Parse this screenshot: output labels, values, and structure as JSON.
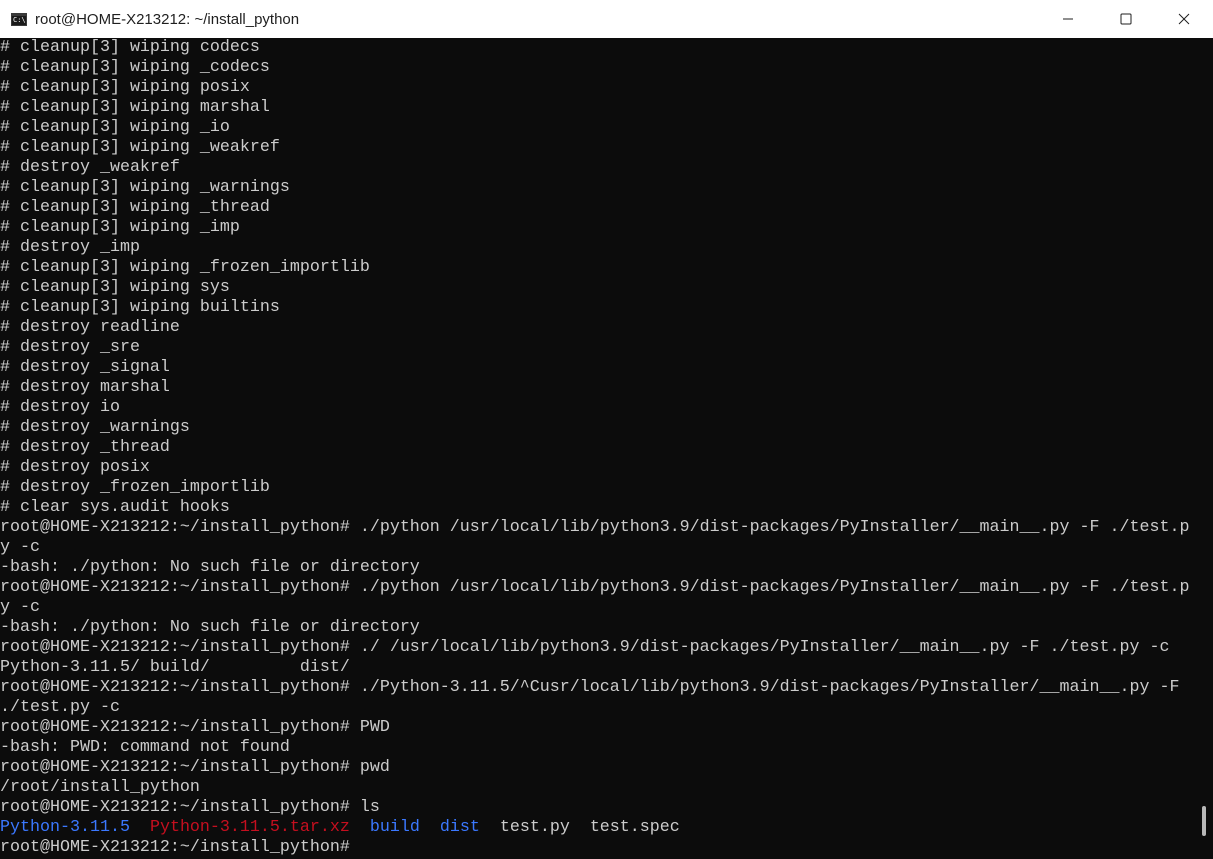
{
  "window": {
    "title": "root@HOME-X213212: ~/install_python",
    "icon": "terminal-app-icon",
    "icon_label": "C:\\",
    "controls": [
      "minimize-icon",
      "maximize-icon",
      "close-icon"
    ]
  },
  "terminal": {
    "lines": [
      "# cleanup[3] wiping codecs",
      "# cleanup[3] wiping _codecs",
      "# cleanup[3] wiping posix",
      "# cleanup[3] wiping marshal",
      "# cleanup[3] wiping _io",
      "# cleanup[3] wiping _weakref",
      "# destroy _weakref",
      "# cleanup[3] wiping _warnings",
      "# cleanup[3] wiping _thread",
      "# cleanup[3] wiping _imp",
      "# destroy _imp",
      "# cleanup[3] wiping _frozen_importlib",
      "# cleanup[3] wiping sys",
      "# cleanup[3] wiping builtins",
      "# destroy readline",
      "# destroy _sre",
      "# destroy _signal",
      "# destroy marshal",
      "# destroy io",
      "# destroy _warnings",
      "# destroy _thread",
      "# destroy posix",
      "# destroy _frozen_importlib",
      "# clear sys.audit hooks",
      "root@HOME-X213212:~/install_python# ./python /usr/local/lib/python3.9/dist-packages/PyInstaller/__main__.py -F ./test.p",
      "y -c",
      "-bash: ./python: No such file or directory",
      "root@HOME-X213212:~/install_python# ./python /usr/local/lib/python3.9/dist-packages/PyInstaller/__main__.py -F ./test.p",
      "y -c",
      "-bash: ./python: No such file or directory",
      "root@HOME-X213212:~/install_python# ./ /usr/local/lib/python3.9/dist-packages/PyInstaller/__main__.py -F ./test.py -c",
      "Python-3.11.5/ build/         dist/",
      "root@HOME-X213212:~/install_python# ./Python-3.11.5/^Cusr/local/lib/python3.9/dist-packages/PyInstaller/__main__.py -F",
      "./test.py -c",
      "root@HOME-X213212:~/install_python# PWD",
      "-bash: PWD: command not found",
      "root@HOME-X213212:~/install_python# pwd",
      "/root/install_python",
      "root@HOME-X213212:~/install_python# ls"
    ],
    "ls_output": {
      "python_dir": "Python-3.11.5",
      "python_tar": "Python-3.11.5.tar.xz",
      "build_dir": "build",
      "dist_dir": "dist",
      "test_py": "test.py",
      "test_spec": "test.spec"
    },
    "final_prompt": "root@HOME-X213212:~/install_python# "
  },
  "colors": {
    "background": "#0c0c0c",
    "foreground": "#cccccc",
    "directory": "#3b78ff",
    "archive": "#c50f1f",
    "titlebar": "#ffffff"
  }
}
